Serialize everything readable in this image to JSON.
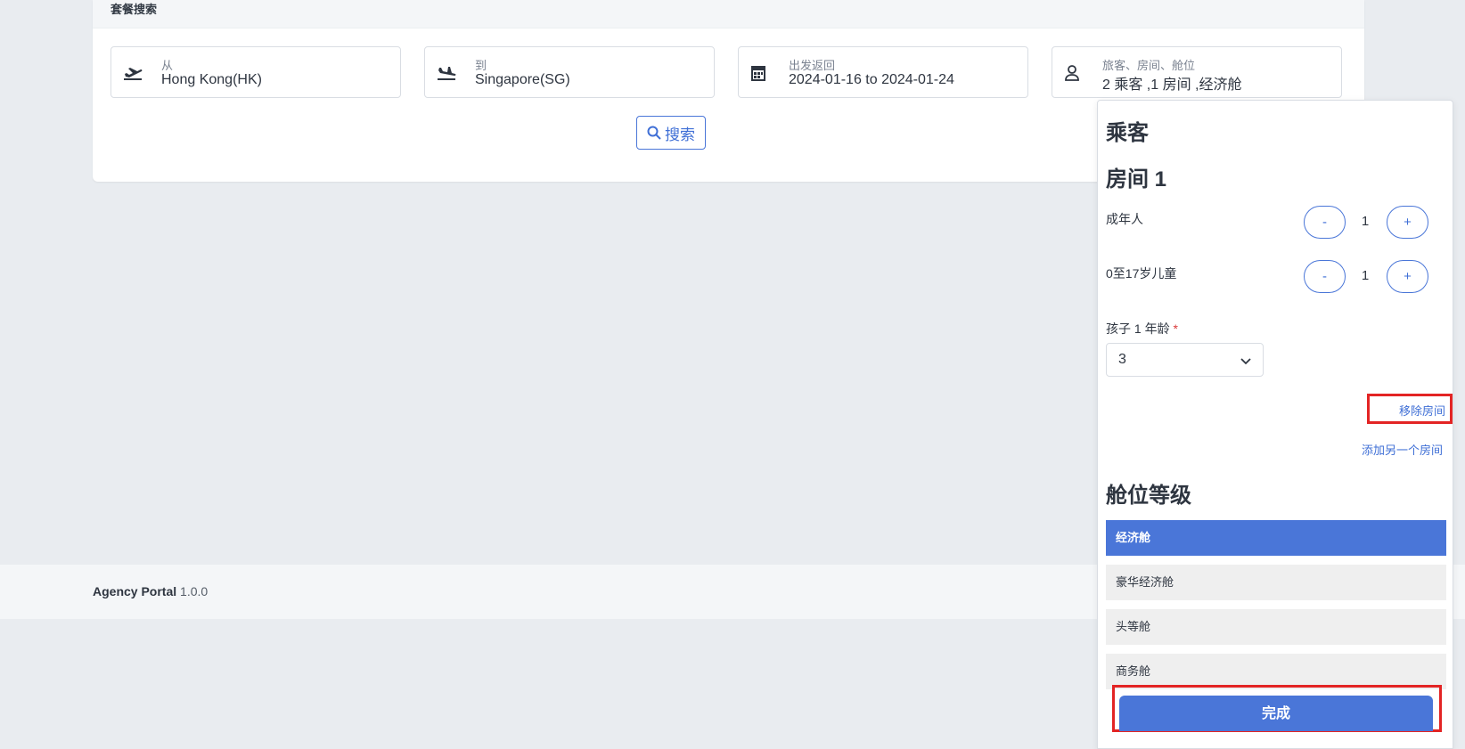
{
  "search": {
    "title": "套餐搜索",
    "from": {
      "label": "从",
      "value": "Hong Kong(HK)",
      "icon": "plane-departure-icon"
    },
    "to": {
      "label": "到",
      "value": "Singapore(SG)",
      "icon": "plane-arrival-icon"
    },
    "dates": {
      "label": "出发返回",
      "value": "2024-01-16 to 2024-01-24",
      "icon": "calendar-icon"
    },
    "travelers": {
      "label": "旅客、房间、舱位",
      "value": "2 乘客 ,1 房间 ,经济舱",
      "icon": "user-icon"
    },
    "search_button": "搜索"
  },
  "footer": {
    "brand": "Agency Portal",
    "version": "1.0.0"
  },
  "popup": {
    "passengers_title": "乘客",
    "room_title": "房间 1",
    "adults": {
      "label": "成年人",
      "minus": "-",
      "value": "1",
      "plus": "+"
    },
    "children": {
      "label": "0至17岁儿童",
      "minus": "-",
      "value": "1",
      "plus": "+"
    },
    "child_age": {
      "label": "孩子 1 年龄",
      "required_mark": "*",
      "value": "3"
    },
    "remove_room": "移除房间",
    "add_room": "添加另一个房间",
    "cabin_title": "舱位等级",
    "cabin_options": [
      "经济舱",
      "豪华经济舱",
      "头等舱",
      "商务舱"
    ],
    "selected_cabin": "经济舱",
    "done_button": "完成"
  },
  "colors": {
    "accent": "#4a76d8",
    "highlight": "#e32424"
  }
}
